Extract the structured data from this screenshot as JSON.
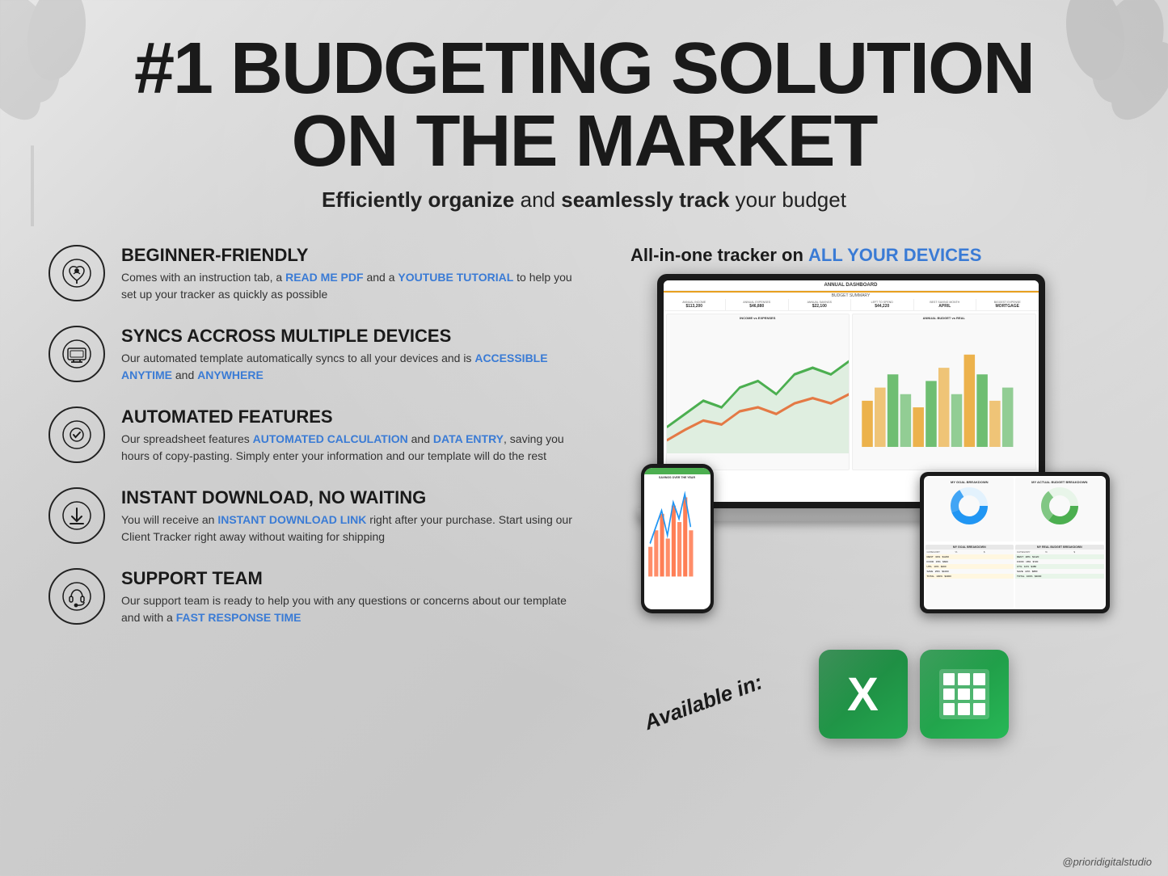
{
  "page": {
    "background": "#d4d4d4"
  },
  "header": {
    "main_title_line1": "#1 BUDGETING SOLUTION",
    "main_title_line2": "ON THE MARKET",
    "subtitle": "Efficiently organize and seamlessly track your budget"
  },
  "features": [
    {
      "id": "beginner-friendly",
      "title": "BEGINNER-FRIENDLY",
      "description_plain": "Comes with an instruction tab, a ",
      "link1_text": "READ ME PDF",
      "description_mid": " and a ",
      "link2_text": "YOUTUBE TUTORIAL",
      "description_end": " to help you set up your tracker as quickly as possible",
      "icon": "plant-money-icon"
    },
    {
      "id": "syncs-devices",
      "title": "SYNCS ACCROSS MULTIPLE DEVICES",
      "description_plain": "Our automated template automatically syncs to all your devices and is ",
      "link1_text": "ACCESSIBLE ANYTIME",
      "description_mid": " and ",
      "link2_text": "ANYWHERE",
      "description_end": "",
      "icon": "devices-sync-icon"
    },
    {
      "id": "automated-features",
      "title": "AUTOMATED FEATURES",
      "description_plain": "Our spreadsheet features ",
      "link1_text": "AUTOMATED CALCULATION",
      "description_mid": " and ",
      "link2_text": "DATA ENTRY",
      "description_end": ", saving you hours of copy-pasting. Simply enter your information and our template will do the rest",
      "icon": "checkmark-gear-icon"
    },
    {
      "id": "instant-download",
      "title": "INSTANT DOWNLOAD, NO WAITING",
      "description_plain": "You will receive an ",
      "link1_text": "INSTANT DOWNLOAD LINK",
      "description_mid": " right after your purchase. Start using our Client Tracker right away without waiting for shipping",
      "description_end": "",
      "icon": "download-icon"
    },
    {
      "id": "support-team",
      "title": "SUPPORT TEAM",
      "description_plain": "Our support team is ready to help you with any questions or concerns about our template and with a ",
      "link1_text": "FAST RESPONSE TIME",
      "description_end": "",
      "icon": "headset-icon"
    }
  ],
  "right_section": {
    "header": "All-in-one tracker on ",
    "header_blue": "ALL YOUR DEVICES",
    "available_text": "Available in:",
    "dashboard_title": "ANNUAL DASHBOARD",
    "dashboard_subtitle": "BUDGET SUMMARY",
    "stats": [
      {
        "label": "ANNUAL INCOME",
        "value": "$113,200"
      },
      {
        "label": "ANNUAL EXPENSES",
        "value": "$46,880"
      },
      {
        "label": "ANNUAL SAVINGS",
        "value": "$22,100"
      },
      {
        "label": "LEFT TO SPEND",
        "value": "$44,220"
      },
      {
        "label": "BEST SAVING MONTH",
        "value": "APRIL"
      },
      {
        "label": "BIGGEST EXPENSE",
        "value": "MORTGAGE"
      }
    ],
    "chart1_title": "INCOME vs EXPENSES",
    "chart2_title": "ANNUAL BUDGET vs REAL"
  },
  "app_icons": [
    {
      "name": "Microsoft Excel",
      "icon_letter": "X"
    },
    {
      "name": "Google Sheets",
      "icon_type": "grid"
    }
  ],
  "watermark": "@prioridigitalstudio"
}
